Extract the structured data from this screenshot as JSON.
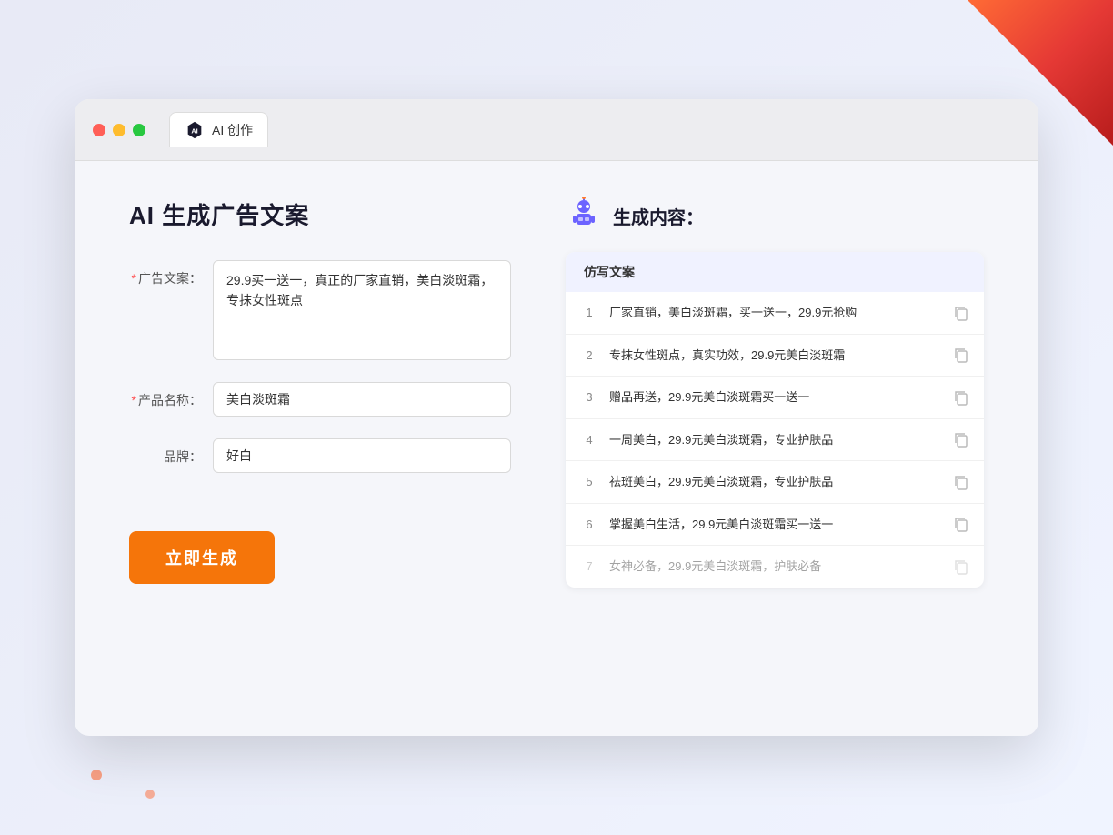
{
  "decorations": {
    "corner_top_right": "decorative",
    "dots": "decorative"
  },
  "browser": {
    "traffic_lights": [
      "red",
      "yellow",
      "green"
    ],
    "tab": {
      "icon_label": "AI",
      "title": "AI 创作"
    }
  },
  "left_panel": {
    "page_title": "AI 生成广告文案",
    "form": {
      "ad_copy_label": "广告文案：",
      "ad_copy_required": "＊",
      "ad_copy_value": "29.9买一送一，真正的厂家直销，美白淡斑霜，专抹女性斑点",
      "product_name_label": "产品名称：",
      "product_name_required": "＊",
      "product_name_value": "美白淡斑霜",
      "brand_label": "品牌：",
      "brand_value": "好白"
    },
    "generate_button": "立即生成"
  },
  "right_panel": {
    "result_header": "生成内容：",
    "table_header": "仿写文案",
    "results": [
      {
        "num": "1",
        "text": "厂家直销，美白淡斑霜，买一送一，29.9元抢购",
        "dimmed": false
      },
      {
        "num": "2",
        "text": "专抹女性斑点，真实功效，29.9元美白淡斑霜",
        "dimmed": false
      },
      {
        "num": "3",
        "text": "赠品再送，29.9元美白淡斑霜买一送一",
        "dimmed": false
      },
      {
        "num": "4",
        "text": "一周美白，29.9元美白淡斑霜，专业护肤品",
        "dimmed": false
      },
      {
        "num": "5",
        "text": "祛斑美白，29.9元美白淡斑霜，专业护肤品",
        "dimmed": false
      },
      {
        "num": "6",
        "text": "掌握美白生活，29.9元美白淡斑霜买一送一",
        "dimmed": false
      },
      {
        "num": "7",
        "text": "女神必备，29.9元美白淡斑霜，护肤必备",
        "dimmed": true
      }
    ]
  }
}
